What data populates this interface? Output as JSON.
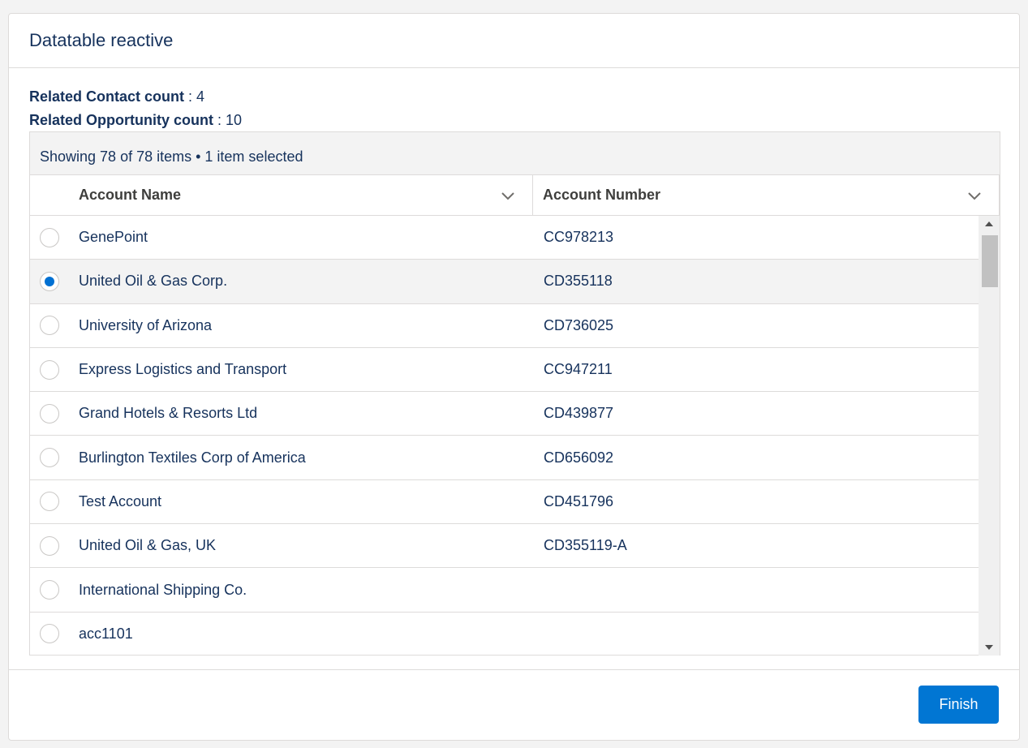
{
  "card": {
    "title": "Datatable reactive"
  },
  "summary": {
    "contact_label": "Related Contact count",
    "contact_value": " : 4",
    "opportunity_label": "Related Opportunity count",
    "opportunity_value": " : 10"
  },
  "table": {
    "info": "Showing 78 of 78 items • 1 item selected",
    "columns": [
      "Account Name",
      "Account Number"
    ],
    "rows": [
      {
        "name": "GenePoint",
        "number": "CC978213",
        "selected": false
      },
      {
        "name": "United Oil & Gas Corp.",
        "number": "CD355118",
        "selected": true
      },
      {
        "name": "University of Arizona",
        "number": "CD736025",
        "selected": false
      },
      {
        "name": "Express Logistics and Transport",
        "number": "CC947211",
        "selected": false
      },
      {
        "name": "Grand Hotels & Resorts Ltd",
        "number": "CD439877",
        "selected": false
      },
      {
        "name": "Burlington Textiles Corp of America",
        "number": "CD656092",
        "selected": false
      },
      {
        "name": "Test Account",
        "number": "CD451796",
        "selected": false
      },
      {
        "name": "United Oil & Gas, UK",
        "number": "CD355119-A",
        "selected": false
      },
      {
        "name": "International Shipping Co.",
        "number": "",
        "selected": false
      },
      {
        "name": "acc1101",
        "number": "",
        "selected": false
      }
    ]
  },
  "footer": {
    "finish_label": "Finish"
  },
  "colors": {
    "accent": "#0176d3",
    "selected_row": "#f3f3f3"
  },
  "icons": {
    "column_menu": "chevron-down-icon",
    "scroll_up": "arrow-up-icon",
    "scroll_down": "arrow-down-icon"
  }
}
